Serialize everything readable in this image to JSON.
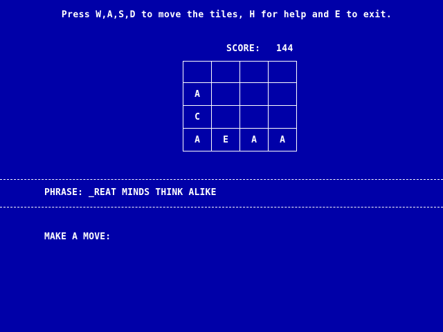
{
  "game": {
    "instructions": "Press W,A,S,D to move the tiles, H for help and E to exit.",
    "score_label": "SCORE:",
    "score_value": "144",
    "grid": [
      [
        "",
        "",
        "",
        ""
      ],
      [
        "A",
        "",
        "",
        ""
      ],
      [
        "C",
        "",
        "",
        ""
      ],
      [
        "A",
        "E",
        "A",
        "A"
      ]
    ],
    "phrase_label": "PHRASE:",
    "phrase_value": "_REAT MINDS THINK ALIKE",
    "prompt": "MAKE A MOVE:"
  },
  "colors": {
    "background": "#0000a8",
    "foreground": "#ffffff"
  }
}
